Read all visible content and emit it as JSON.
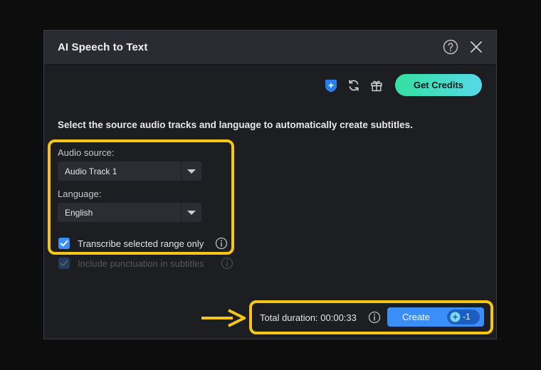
{
  "dialog": {
    "title": "AI Speech to Text"
  },
  "toolbar": {
    "icons": [
      "credit-shield-icon",
      "refresh-icon",
      "gift-icon"
    ],
    "get_credits_label": "Get Credits"
  },
  "instruction": "Select the source audio tracks and language to automatically create subtitles.",
  "audio_source": {
    "label": "Audio source:",
    "value": "Audio Track 1"
  },
  "language": {
    "label": "Language:",
    "value": "English"
  },
  "options": [
    {
      "label": "Transcribe selected range only",
      "checked": true,
      "enabled": true
    },
    {
      "label": "Include punctuation in subtitles",
      "checked": true,
      "enabled": false
    }
  ],
  "footer": {
    "duration_text": "Total duration: 00:00:33",
    "create_label": "Create",
    "credit_cost": "-1"
  },
  "colors": {
    "accent": "#3a8ef6",
    "credits_gradient_start": "#33e0a0",
    "credits_gradient_end": "#58d8e8",
    "annotation": "#f5c518"
  }
}
